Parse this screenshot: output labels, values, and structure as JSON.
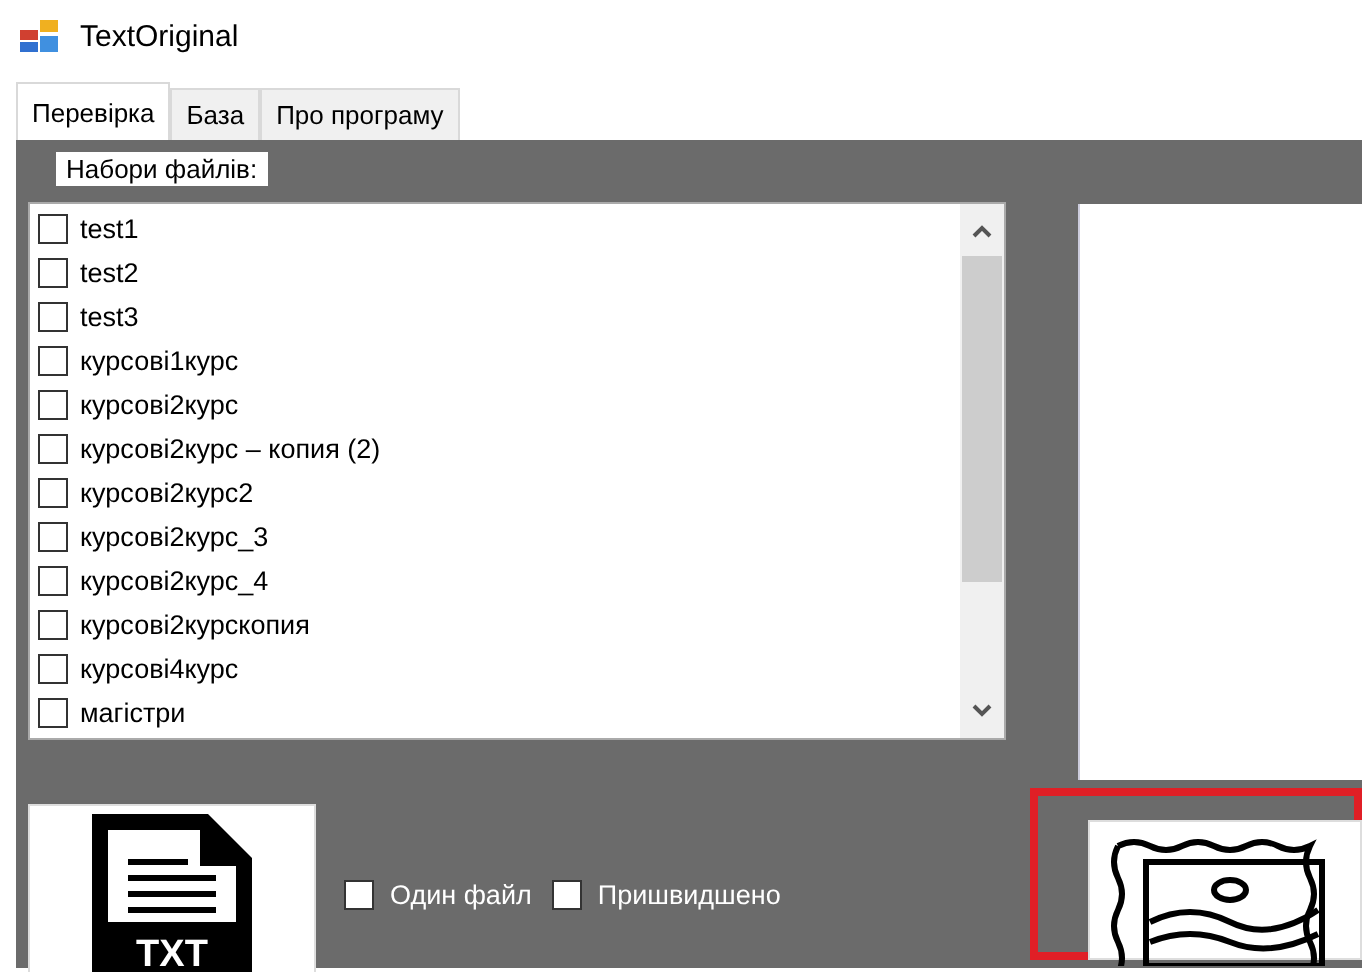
{
  "window": {
    "title": "TextOriginal"
  },
  "tabs": [
    {
      "label": "Перевірка",
      "selected": true
    },
    {
      "label": "База",
      "selected": false
    },
    {
      "label": "Про програму",
      "selected": false
    }
  ],
  "file_sets": {
    "label": "Набори файлів:",
    "items": [
      {
        "label": "test1",
        "checked": false
      },
      {
        "label": "test2",
        "checked": false
      },
      {
        "label": "test3",
        "checked": false
      },
      {
        "label": "курсові1курс",
        "checked": false
      },
      {
        "label": "курсові2курс",
        "checked": false
      },
      {
        "label": "курсові2курс – копия (2)",
        "checked": false
      },
      {
        "label": "курсові2курс2",
        "checked": false
      },
      {
        "label": "курсові2курс_3",
        "checked": false
      },
      {
        "label": "курсові2курс_4",
        "checked": false
      },
      {
        "label": "курсові2курскопия",
        "checked": false
      },
      {
        "label": "курсові4курс",
        "checked": false
      },
      {
        "label": "магістри",
        "checked": false
      }
    ]
  },
  "txt_button": {
    "text": "TXT"
  },
  "options": [
    {
      "label": "Один файл",
      "checked": false
    },
    {
      "label": "Пришвидшено",
      "checked": false
    }
  ]
}
